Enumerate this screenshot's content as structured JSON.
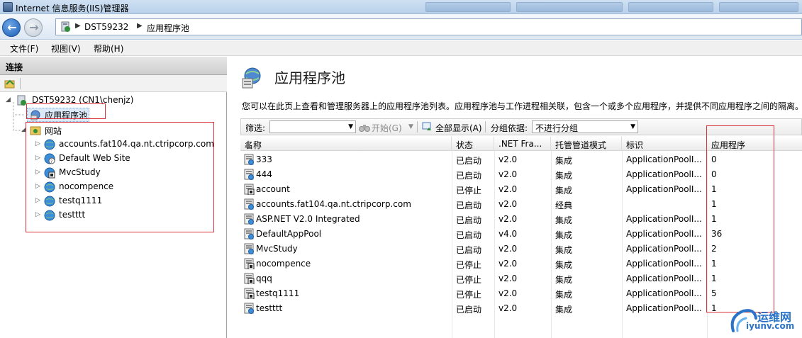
{
  "window": {
    "title": "Internet 信息服务(IIS)管理器"
  },
  "address": {
    "crumbs": [
      "DST59232",
      "应用程序池"
    ]
  },
  "menu": [
    {
      "label": "文件(F)"
    },
    {
      "label": "视图(V)"
    },
    {
      "label": "帮助(H)"
    }
  ],
  "connections": {
    "header": "连接",
    "server": "DST59232 (CN1\\chenjz)",
    "app_pools": "应用程序池",
    "sites_label": "网站",
    "sites": [
      "accounts.fat104.qa.nt.ctripcorp.com",
      "Default Web Site",
      "MvcStudy",
      "nocompence",
      "testq1111",
      "testttt"
    ]
  },
  "main": {
    "title": "应用程序池",
    "description": "您可以在此页上查看和管理服务器上的应用程序池列表。应用程序池与工作进程相关联，包含一个或多个应用程序，并提供不同应用程序之间的隔离。",
    "filter": {
      "label": "筛选:",
      "start_label": "开始(G)",
      "show_all_label": "全部显示(A)",
      "group_label": "分组依据:",
      "group_value": "不进行分组"
    },
    "columns": [
      "名称",
      "状态",
      ".NET Fra...",
      "托管管道模式",
      "标识",
      "应用程序"
    ],
    "rows": [
      {
        "name": "333",
        "status": "已启动",
        "net": "v2.0",
        "mode": "集成",
        "identity": "ApplicationPoolI...",
        "apps": "0",
        "icon": "pool-running-icon"
      },
      {
        "name": "444",
        "status": "已启动",
        "net": "v2.0",
        "mode": "集成",
        "identity": "ApplicationPoolI...",
        "apps": "0",
        "icon": "pool-running-icon"
      },
      {
        "name": "account",
        "status": "已停止",
        "net": "v2.0",
        "mode": "集成",
        "identity": "ApplicationPoolI...",
        "apps": "1",
        "icon": "pool-stopped-icon"
      },
      {
        "name": "accounts.fat104.qa.nt.ctripcorp.com",
        "status": "已启动",
        "net": "v2.0",
        "mode": "经典",
        "identity": "",
        "apps": "1",
        "icon": "pool-running-icon"
      },
      {
        "name": "ASP.NET V2.0 Integrated",
        "status": "已启动",
        "net": "v2.0",
        "mode": "集成",
        "identity": "ApplicationPoolI...",
        "apps": "1",
        "icon": "pool-running-icon"
      },
      {
        "name": "DefaultAppPool",
        "status": "已启动",
        "net": "v4.0",
        "mode": "集成",
        "identity": "ApplicationPoolI...",
        "apps": "36",
        "icon": "pool-running-icon"
      },
      {
        "name": "MvcStudy",
        "status": "已启动",
        "net": "v2.0",
        "mode": "集成",
        "identity": "ApplicationPoolI...",
        "apps": "2",
        "icon": "pool-running-icon"
      },
      {
        "name": "nocompence",
        "status": "已停止",
        "net": "v2.0",
        "mode": "集成",
        "identity": "ApplicationPoolI...",
        "apps": "1",
        "icon": "pool-stopped-icon"
      },
      {
        "name": "qqq",
        "status": "已停止",
        "net": "v2.0",
        "mode": "集成",
        "identity": "ApplicationPoolI...",
        "apps": "1",
        "icon": "pool-stopped-icon"
      },
      {
        "name": "testq1111",
        "status": "已停止",
        "net": "v2.0",
        "mode": "集成",
        "identity": "ApplicationPoolI...",
        "apps": "5",
        "icon": "pool-stopped-icon"
      },
      {
        "name": "testttt",
        "status": "已启动",
        "net": "v2.0",
        "mode": "集成",
        "identity": "ApplicationPoolI...",
        "apps": "1",
        "icon": "pool-running-icon"
      }
    ]
  },
  "watermark": {
    "name": "运维网",
    "url": "iyunv.com"
  },
  "colors": {
    "accent": "#2a73c9",
    "highlight_box": "#d9303a",
    "selection": "#dce9f8"
  }
}
